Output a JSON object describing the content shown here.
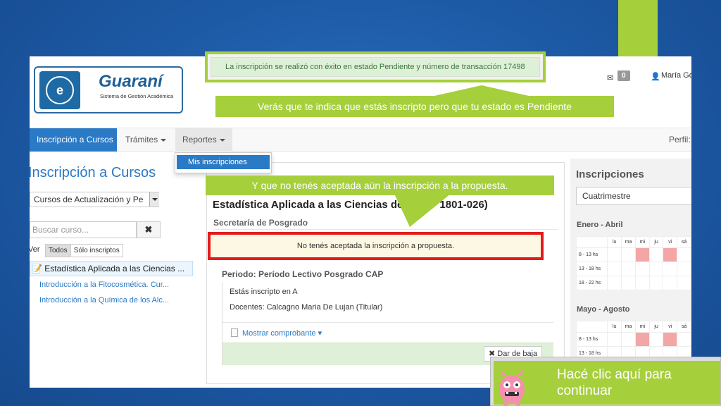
{
  "header": {
    "logo_title": "Guaraní",
    "logo_subtitle": "Sistema de Gestión Académica",
    "messages_count": "0",
    "user_name": "María Go"
  },
  "colors": {
    "brand_blue": "#2a7ac6",
    "tutorial_green": "#a6cf3c",
    "alert_red": "#e41b1b",
    "busy_slot": "#f4a6a6"
  },
  "navbar": {
    "items": [
      {
        "label": "Inscripción a Cursos",
        "active": true
      },
      {
        "label": "Trámites",
        "has_dropdown": true
      },
      {
        "label": "Reportes",
        "has_dropdown": true,
        "open": true
      }
    ],
    "perfil": "Perfil:",
    "reportes_menu": [
      "Mis inscripciones"
    ]
  },
  "left": {
    "title": "Inscripción a Cursos",
    "select_value": "Cursos de Actualización y Pe",
    "search_placeholder": "Buscar curso...",
    "ver_label": "Ver",
    "filters": [
      "Todos",
      "Sólo inscriptos"
    ],
    "active_filter": "Todos",
    "courses": [
      "Estadística Aplicada a las Ciencias ...",
      "Introducción a la Fitocosmética. Cur...",
      "Introducción a la Química de los Alc..."
    ]
  },
  "center": {
    "course_title_left": "Estadística Aplicada a las Ciencias de",
    "course_title_right": "1801-026)",
    "subtitle": "Secretaría de Posgrado",
    "warning": "No tenés aceptada la inscripción a propuesta.",
    "periodo": "Periodo: Período Lectivo Posgrado CAP",
    "inscripto": "Estás inscripto en A",
    "docentes": "Docentes: Calcagno Maria De Lujan (Titular)",
    "mostrar": "Mostrar comprobante ▾",
    "baja_button": "Dar de baja"
  },
  "right": {
    "title": "Inscripciones",
    "select_value": "Cuatrimestre",
    "days": [
      "lu",
      "ma",
      "mi",
      "ju",
      "vi",
      "sá"
    ],
    "periods": [
      {
        "label": "Enero - Abril",
        "slots": [
          "8 - 13 hs",
          "13 - 18 hs",
          "18 - 22 hs"
        ]
      },
      {
        "label": "Mayo - Agosto",
        "slots": [
          "8 - 13 hs",
          "13 - 18 hs"
        ]
      }
    ]
  },
  "tutorial": {
    "success_message": "La inscripción se realizó con éxito en estado Pendiente y número de transacción 17498",
    "callout_1": "Verás que te indica que estás inscripto pero que tu estado es Pendiente",
    "callout_2": "Y que  no tenés aceptada aún la inscripción a la propuesta.",
    "cta_text": "Hacé clic aquí para continuar"
  }
}
